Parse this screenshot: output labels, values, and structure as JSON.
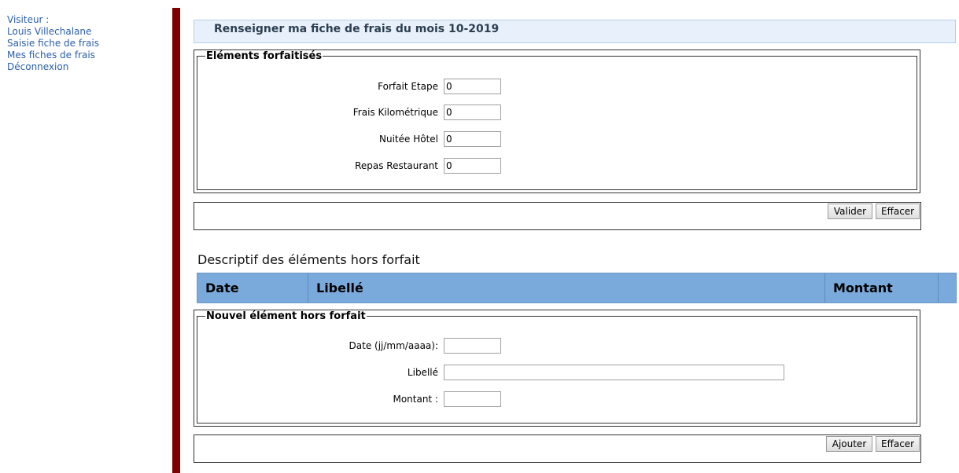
{
  "menu": {
    "visitor_label": "Visiteur :",
    "visitor_name": "Louis Villechalane",
    "items": [
      {
        "label": "Saisie fiche de frais"
      },
      {
        "label": "Mes fiches de frais"
      },
      {
        "label": "Déconnexion"
      }
    ]
  },
  "colors": {
    "menu_link": "#2a5fa8",
    "side_bar": "#800000",
    "title_bg": "#e8f1fb",
    "table_header_bg": "#7aaadb"
  },
  "title": "Renseigner ma fiche de frais du mois 10-2019",
  "forfait": {
    "legend": "Eléments forfaitisés",
    "fields": [
      {
        "label": "Forfait Etape",
        "value": "0"
      },
      {
        "label": "Frais Kilométrique",
        "value": "0"
      },
      {
        "label": "Nuitée Hôtel",
        "value": "0"
      },
      {
        "label": "Repas Restaurant",
        "value": "0"
      }
    ],
    "validate_label": "Valider",
    "clear_label": "Effacer"
  },
  "hors_forfait": {
    "heading": "Descriptif des éléments hors forfait",
    "columns": {
      "date": "Date",
      "libelle": "Libellé",
      "montant": "Montant"
    }
  },
  "nouvel": {
    "legend": "Nouvel élément hors forfait",
    "fields": [
      {
        "label": "Date (jj/mm/aaaa):",
        "value": ""
      },
      {
        "label": "Libellé",
        "value": ""
      },
      {
        "label": "Montant :",
        "value": ""
      }
    ],
    "add_label": "Ajouter",
    "clear_label": "Effacer"
  }
}
